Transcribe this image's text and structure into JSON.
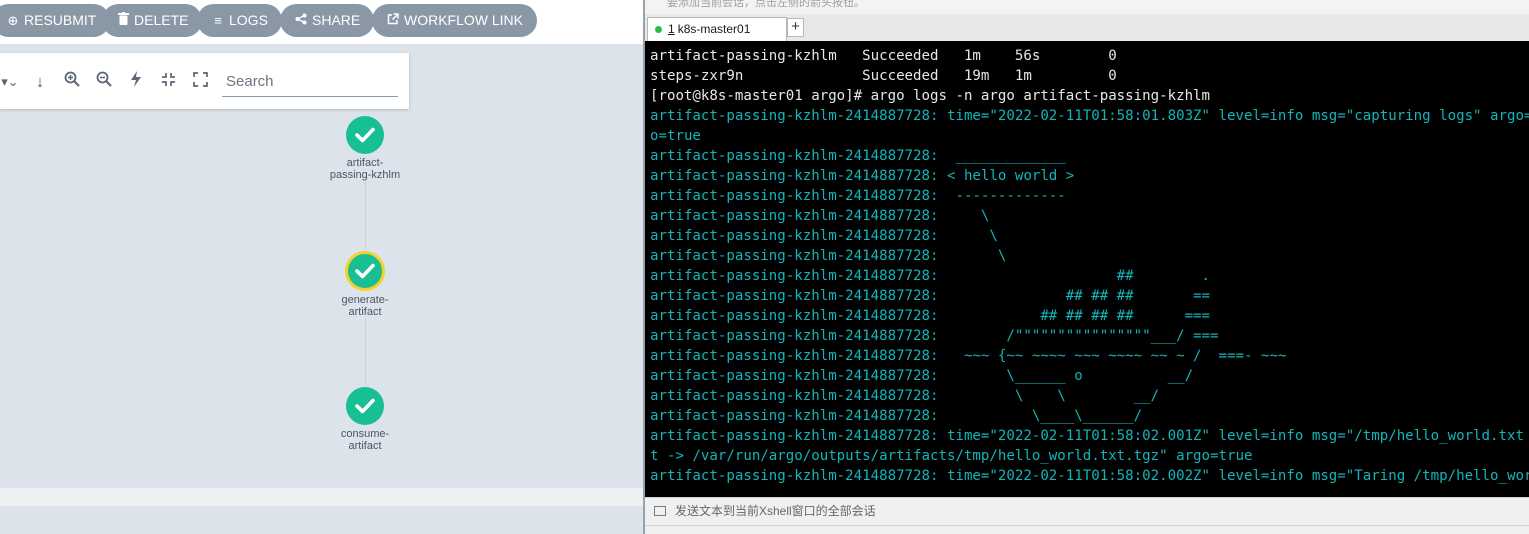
{
  "argo": {
    "toolbar": {
      "buttons": [
        {
          "label": "RESUBMIT",
          "icon": "plus-circle-icon"
        },
        {
          "label": "DELETE",
          "icon": "trash-icon"
        },
        {
          "label": "LOGS",
          "icon": "list-icon"
        },
        {
          "label": "SHARE",
          "icon": "share-icon"
        },
        {
          "label": "WORKFLOW LINK",
          "icon": "external-link-icon"
        }
      ]
    },
    "graph_tools": {
      "search_placeholder": "Search",
      "icons": [
        "filter-icon",
        "download-icon",
        "zoom-in-icon",
        "zoom-out-icon",
        "lightning-icon",
        "collapse-icon",
        "expand-icon"
      ]
    },
    "nodes": [
      {
        "label_line1": "artifact-",
        "label_line2": "passing-kzhlm",
        "status": "succeeded"
      },
      {
        "label_line1": "generate-",
        "label_line2": "artifact",
        "status": "succeeded",
        "selected": true
      },
      {
        "label_line1": "consume-",
        "label_line2": "artifact",
        "status": "succeeded"
      }
    ],
    "colors": {
      "node_success": "#18be94",
      "node_selected_ring": "#f4d22b",
      "button_bg": "#8a98a6"
    }
  },
  "xshell": {
    "top_hint": "要添加当前会话，点击左侧的箭头按钮。",
    "tab": {
      "number": "1",
      "name": "k8s-master01"
    },
    "new_tab": "+",
    "terminal_lines": [
      {
        "text": "artifact-passing-kzhlm   Succeeded   1m    56s        0",
        "style": "w"
      },
      {
        "text": "steps-zxr9n              Succeeded   19m   1m         0",
        "style": "w"
      },
      {
        "text": "[root@k8s-master01 argo]# argo logs -n argo artifact-passing-kzhlm",
        "style": "w"
      },
      {
        "text": "artifact-passing-kzhlm-2414887728: time=\"2022-02-11T01:58:01.803Z\" level=info msg=\"capturing logs\" argo=true",
        "style": "c"
      },
      {
        "text": "o=true",
        "style": "c"
      },
      {
        "text": "artifact-passing-kzhlm-2414887728:  _____________",
        "style": "c"
      },
      {
        "text": "artifact-passing-kzhlm-2414887728: < hello world >",
        "style": "c"
      },
      {
        "text": "artifact-passing-kzhlm-2414887728:  -------------",
        "style": "c"
      },
      {
        "text": "artifact-passing-kzhlm-2414887728:     \\",
        "style": "c"
      },
      {
        "text": "artifact-passing-kzhlm-2414887728:      \\",
        "style": "c"
      },
      {
        "text": "artifact-passing-kzhlm-2414887728:       \\",
        "style": "c"
      },
      {
        "text": "artifact-passing-kzhlm-2414887728:                     ##        .",
        "style": "c"
      },
      {
        "text": "artifact-passing-kzhlm-2414887728:               ## ## ##       ==",
        "style": "c"
      },
      {
        "text": "artifact-passing-kzhlm-2414887728:            ## ## ## ##      ===",
        "style": "c"
      },
      {
        "text": "artifact-passing-kzhlm-2414887728:        /\"\"\"\"\"\"\"\"\"\"\"\"\"\"\"\"___/ ===",
        "style": "c"
      },
      {
        "text": "artifact-passing-kzhlm-2414887728:   ~~~ {~~ ~~~~ ~~~ ~~~~ ~~ ~ /  ===- ~~~",
        "style": "c"
      },
      {
        "text": "artifact-passing-kzhlm-2414887728:        \\______ o          __/",
        "style": "c"
      },
      {
        "text": "artifact-passing-kzhlm-2414887728:         \\    \\        __/",
        "style": "c"
      },
      {
        "text": "artifact-passing-kzhlm-2414887728:           \\____\\______/",
        "style": "c"
      },
      {
        "text": "artifact-passing-kzhlm-2414887728: time=\"2022-02-11T01:58:02.001Z\" level=info msg=\"/tmp/hello_world.txt",
        "style": "c"
      },
      {
        "text": "t -> /var/run/argo/outputs/artifacts/tmp/hello_world.txt.tgz\" argo=true",
        "style": "c"
      },
      {
        "text": "artifact-passing-kzhlm-2414887728: time=\"2022-02-11T01:58:02.002Z\" level=info msg=\"Taring /tmp/hello_world.txt\"",
        "style": "c"
      }
    ],
    "send_bar": "发送文本到当前Xshell窗口的全部会话",
    "colors": {
      "terminal_bg": "#000000",
      "text_white": "#e8e8e8",
      "text_cyan": "#12b6b9"
    }
  }
}
